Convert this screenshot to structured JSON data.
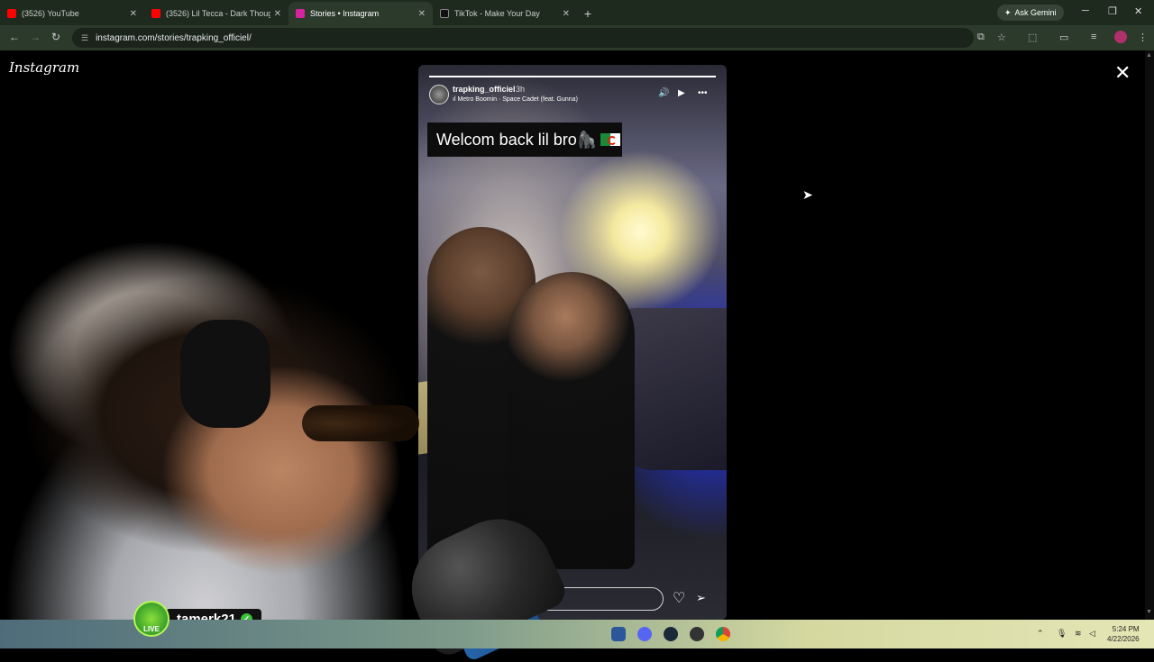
{
  "browser": {
    "tabs": [
      {
        "title": "(3526) YouTube",
        "favicon_color": "#ff0000",
        "active": false
      },
      {
        "title": "(3526) Lil Tecca - Dark Thoughts",
        "favicon_color": "#ff0000",
        "active": false
      },
      {
        "title": "Stories • Instagram",
        "favicon_color": "#d6249f",
        "active": true
      },
      {
        "title": "TikTok - Make Your Day",
        "favicon_color": "#111111",
        "active": false
      }
    ],
    "new_tab": "+",
    "gemini_label": "Ask Gemini",
    "url": "instagram.com/stories/trapking_officiel/"
  },
  "page": {
    "logo": "Instagram",
    "close": "✕"
  },
  "story": {
    "username": "trapking_officiel",
    "time": "3h",
    "music": "Metro Boomin · Space Cadet (feat. Gunna)",
    "caption": "Welcom back lil bro🦍",
    "progress": 1.0
  },
  "overlay": {
    "streamer_name": "tamerk21",
    "live_label": "LIVE"
  },
  "taskbar": {
    "time": "5:24 PM",
    "date": "4/22/2026"
  },
  "colors": {
    "chrome_frame": "#1f2a1f",
    "active_tab": "#2c3a2c",
    "page_bg": "#000000",
    "live_green": "#3aa02a"
  }
}
